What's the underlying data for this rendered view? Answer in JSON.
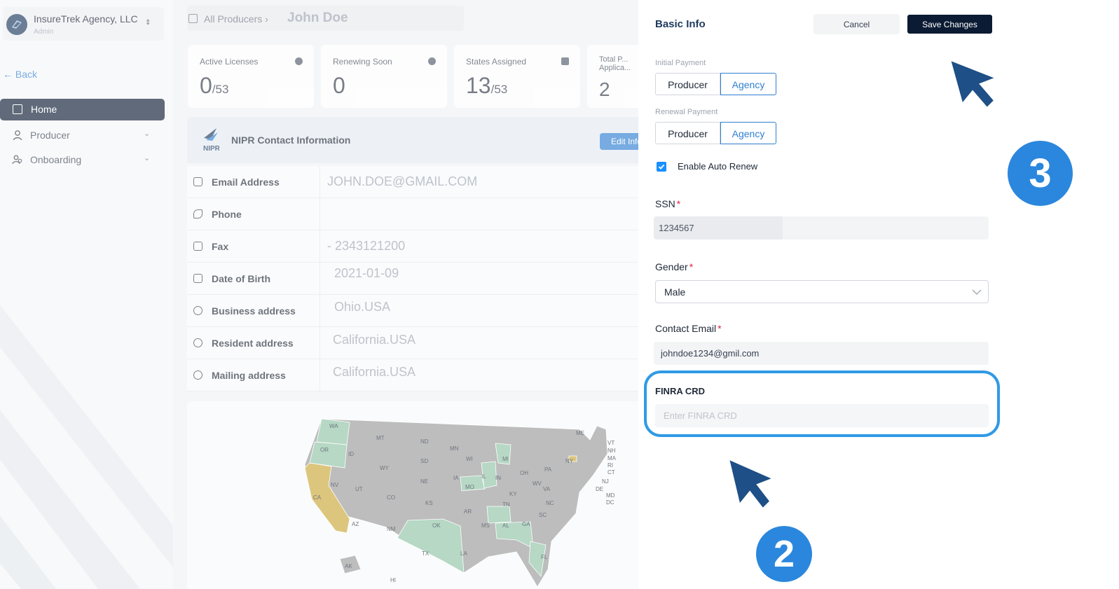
{
  "sidebar": {
    "agency_name": "InsureTrek Agency, LLC",
    "agency_role": "Admin",
    "back_label": "← Back",
    "items": [
      {
        "label": "Home"
      },
      {
        "label": "Producer"
      },
      {
        "label": "Onboarding"
      }
    ]
  },
  "header": {
    "breadcrumb_parent": "All Producers ›",
    "breadcrumb_current": "John Doe"
  },
  "stats": [
    {
      "title": "Active Licenses",
      "value": "0",
      "total": "/53"
    },
    {
      "title": "Renewing Soon",
      "value": "0",
      "total": ""
    },
    {
      "title": "States Assigned",
      "value": "13",
      "total": "/53"
    },
    {
      "title": "Total P... Applica...",
      "value": "2",
      "total": ""
    }
  ],
  "nipr": {
    "title": "NIPR Contact Information",
    "logo_text": "NIPR",
    "edit_label": "Edit Info",
    "rows": [
      {
        "label": "Email Address",
        "value": "JOHN.DOE@GMAIL.COM"
      },
      {
        "label": "Phone",
        "value": ""
      },
      {
        "label": "Fax",
        "value": "- 2343121200"
      },
      {
        "label": "Date of Birth",
        "value": "2021-01-09"
      },
      {
        "label": "Business address",
        "value": "Ohio.USA"
      },
      {
        "label": "Resident address",
        "value": "California.USA"
      },
      {
        "label": "Mailing address",
        "value": "California.USA"
      }
    ]
  },
  "map": {
    "state_labels": [
      "WA",
      "OR",
      "CA",
      "ID",
      "NV",
      "MT",
      "WY",
      "UT",
      "AZ",
      "CO",
      "NM",
      "ND",
      "SD",
      "NE",
      "KS",
      "OK",
      "TX",
      "MN",
      "IA",
      "MO",
      "AR",
      "LA",
      "WI",
      "IL",
      "MS",
      "MI",
      "IN",
      "KY",
      "TN",
      "AL",
      "GA",
      "FL",
      "OH",
      "WV",
      "VA",
      "NC",
      "SC",
      "PA",
      "NY",
      "ME",
      "VT",
      "NH",
      "MA",
      "RI",
      "CT",
      "NJ",
      "DE",
      "MD",
      "DC",
      "AK",
      "HI"
    ],
    "colors": {
      "licensed": "#8fc4a6",
      "resident": "#c9a838",
      "none": "#9a9a9a"
    }
  },
  "drawer": {
    "title": "Basic Info",
    "cancel_label": "Cancel",
    "save_label": "Save Changes",
    "initial_payment": {
      "label": "Initial Payment",
      "options": [
        "Producer",
        "Agency"
      ],
      "selected": "Agency"
    },
    "renewal_payment": {
      "label": "Renewal Payment",
      "options": [
        "Producer",
        "Agency"
      ],
      "selected": "Agency"
    },
    "auto_renew": {
      "label": "Enable Auto Renew",
      "checked": true
    },
    "ssn": {
      "label": "SSN",
      "value": "1234567"
    },
    "gender": {
      "label": "Gender",
      "value": "Male"
    },
    "contact_email": {
      "label": "Contact Email",
      "value": "johndoe1234@gmil.com"
    },
    "finra": {
      "label": "FINRA CRD",
      "placeholder": "Enter FINRA CRD"
    },
    "required_mark": "*"
  },
  "annotations": {
    "step_a": "2",
    "step_b": "3",
    "color": "#2b87dd"
  }
}
